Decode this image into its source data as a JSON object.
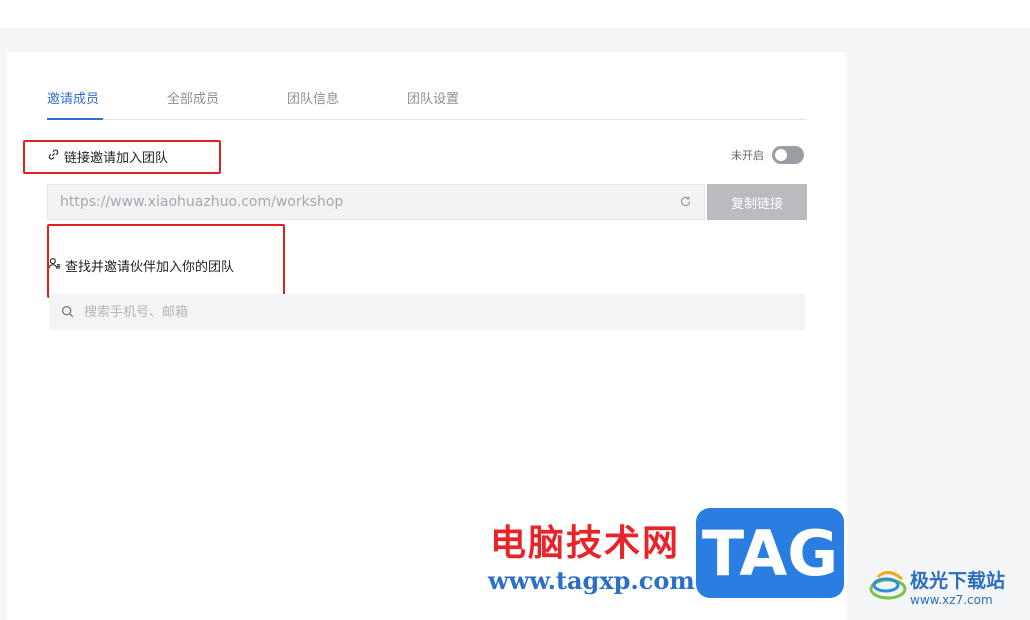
{
  "tabs": [
    {
      "label": "邀请成员",
      "active": true
    },
    {
      "label": "全部成员",
      "active": false
    },
    {
      "label": "团队信息",
      "active": false
    },
    {
      "label": "团队设置",
      "active": false
    }
  ],
  "link_invite": {
    "title": "链接邀请加入团队",
    "icon": "link-icon",
    "toggle_label": "未开启",
    "toggle_on": false,
    "url_value": "https://www.xiaohuazhuo.com/workshop",
    "refresh_icon": "refresh-icon",
    "copy_label": "复制链接"
  },
  "partner_invite": {
    "title": "查找并邀请伙伴加入你的团队",
    "icon": "add-user-icon",
    "search_placeholder": "搜索手机号、邮箱",
    "search_icon": "search-icon"
  },
  "watermark": {
    "cn_text": "电脑技术网",
    "url": "www.tagxp.com",
    "tag": "TAG",
    "site_name": "极光下载站",
    "site_url": "www.xz7.com"
  },
  "colors": {
    "accent": "#2f6fd6",
    "highlight_box": "#e02020",
    "copy_button": "#b9bbbf",
    "toggle_off": "#9a9da3"
  }
}
